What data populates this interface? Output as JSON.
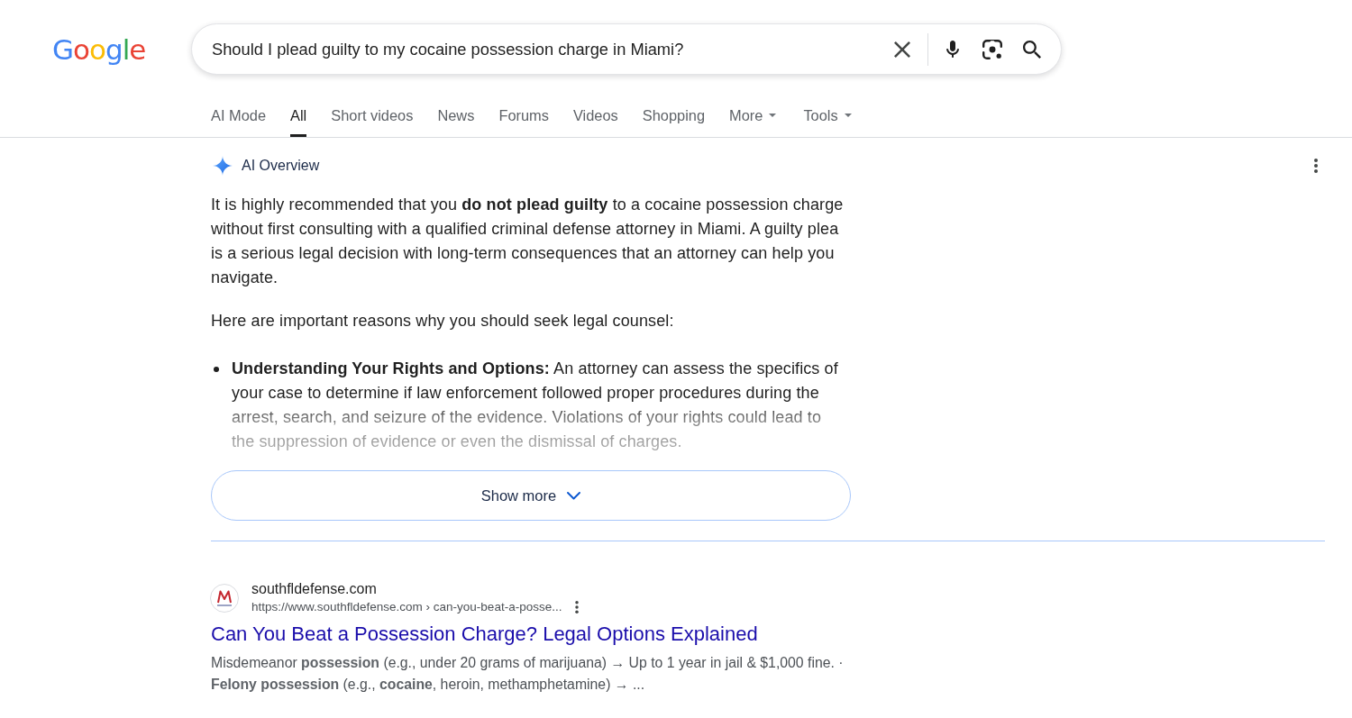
{
  "logo": {
    "letters": [
      {
        "char": "G",
        "color": "#4285f4"
      },
      {
        "char": "o",
        "color": "#ea4335"
      },
      {
        "char": "o",
        "color": "#fbbc05"
      },
      {
        "char": "g",
        "color": "#4285f4"
      },
      {
        "char": "l",
        "color": "#34a853"
      },
      {
        "char": "e",
        "color": "#ea4335"
      }
    ]
  },
  "search": {
    "value": "Should I plead guilty to my cocaine possession charge in Miami?"
  },
  "tabs": [
    {
      "label": "AI Mode",
      "kind": "link",
      "selected": false
    },
    {
      "label": "All",
      "kind": "link",
      "selected": true
    },
    {
      "label": "Short videos",
      "kind": "link",
      "selected": false
    },
    {
      "label": "News",
      "kind": "link",
      "selected": false
    },
    {
      "label": "Forums",
      "kind": "link",
      "selected": false
    },
    {
      "label": "Videos",
      "kind": "link",
      "selected": false
    },
    {
      "label": "Shopping",
      "kind": "link",
      "selected": false
    },
    {
      "label": "More",
      "kind": "menu",
      "selected": false
    },
    {
      "label": "Tools",
      "kind": "menu",
      "selected": false
    }
  ],
  "ai_overview": {
    "title": "AI Overview",
    "paragraphs": [
      "It is highly recommended that you **do not plead guilty** to a cocaine possession charge without first consulting with a qualified criminal defense attorney in Miami. A guilty plea is a serious legal decision with long-term consequences that an attorney can help you navigate.",
      "Here are important reasons why you should seek legal counsel:"
    ],
    "bullets": [
      "**Understanding Your Rights and Options:** An attorney can assess the specifics of your case to determine if law enforcement followed proper procedures during the arrest, search, and seizure of the evidence. Violations of your rights could lead to the suppression of evidence or even the dismissal of charges."
    ],
    "show_more": "Show more"
  },
  "results": [
    {
      "site": "southfldefense.com",
      "url": "https://www.southfldefense.com › can-you-beat-a-posse...",
      "title": "Can You Beat a Possession Charge? Legal Options Explained",
      "snippet": "Misdemeanor **possession** (e.g., under 20 grams of marijuana) → Up to 1 year in jail & $1,000 fine. · **Felony possession** (e.g., **cocaine**, heroin, methamphetamine) → ..."
    }
  ]
}
